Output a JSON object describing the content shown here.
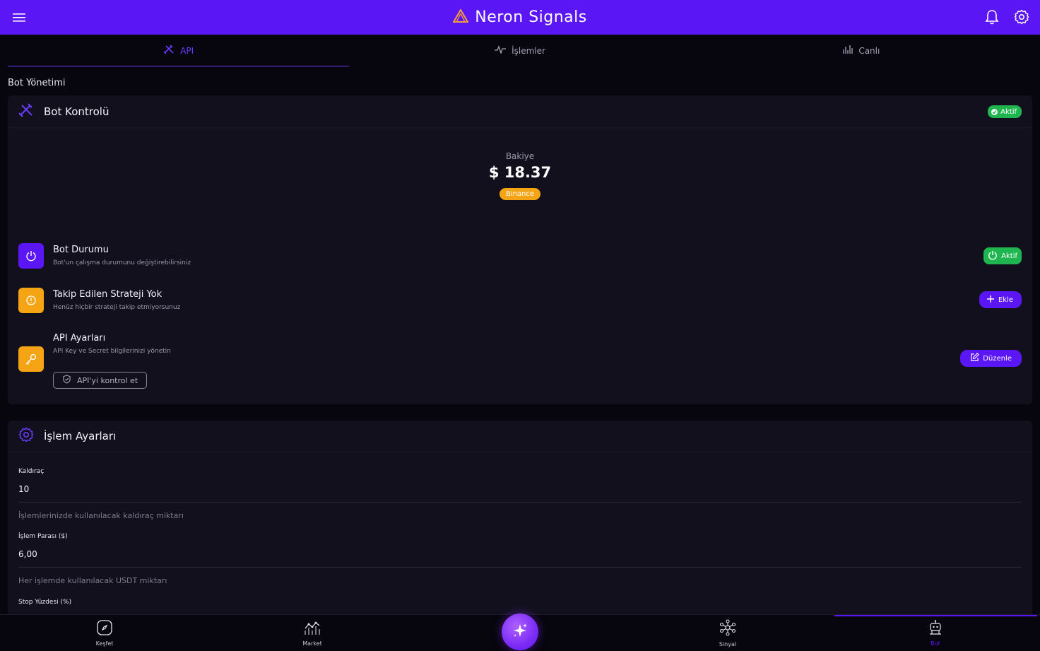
{
  "app": {
    "title": "Neron Signals"
  },
  "tabs": [
    {
      "label": "API",
      "icon": "tools-icon",
      "active": true
    },
    {
      "label": "İşlemler",
      "icon": "pulse-icon",
      "active": false
    },
    {
      "label": "Canlı",
      "icon": "bar-chart-icon",
      "active": false
    }
  ],
  "section_title": "Bot Yönetimi",
  "bot_control": {
    "title": "Bot Kontrolü",
    "status_badge": "Aktif",
    "balance_label": "Bakiye",
    "balance_value": "$ 18.37",
    "exchange": "Binance",
    "rows": [
      {
        "title": "Bot Durumu",
        "subtitle": "Bot'un çalışma durumunu değiştirebilirsiniz",
        "button": "Aktif",
        "icon": "power-icon",
        "color": "#5b16f6",
        "button_color": "#1fb64f"
      },
      {
        "title": "Takip Edilen Strateji Yok",
        "subtitle": "Henüz hiçbir strateji takip etmiyorsunuz",
        "button": "Ekle",
        "icon": "alert-circle-icon",
        "color": "#f5a413",
        "button_color": "#5b16f6"
      },
      {
        "title": "API Ayarları",
        "subtitle": "API Key ve Secret bilgilerinizi yönetin",
        "button": "Düzenle",
        "icon": "key-icon",
        "color": "#f5a413",
        "button_color": "#5b16f6",
        "secondary_button": "API'yi kontrol et"
      }
    ]
  },
  "trade_settings": {
    "title": "İşlem Ayarları",
    "fields": [
      {
        "label": "Kaldıraç",
        "value": "10",
        "help": "İşlemlerinizde kullanılacak kaldıraç miktarı"
      },
      {
        "label": "İşlem Parası ($)",
        "value": "6,00",
        "help": "Her işlemde kullanılacak USDT miktarı"
      },
      {
        "label": "Stop Yüzdesi (%)",
        "value": "",
        "help": ""
      }
    ]
  },
  "bottom_nav": [
    {
      "label": "Keşfet",
      "icon": "compass-icon",
      "active": false
    },
    {
      "label": "Market",
      "icon": "line-chart-icon",
      "active": false
    },
    {
      "label": "Sinyal",
      "icon": "network-icon",
      "active": false
    },
    {
      "label": "Bot",
      "icon": "robot-icon",
      "active": true
    }
  ],
  "colors": {
    "brand": "#5b16f6",
    "success": "#1fb64f",
    "warning": "#f5a413",
    "background": "#07050d",
    "card": "#12101d"
  }
}
